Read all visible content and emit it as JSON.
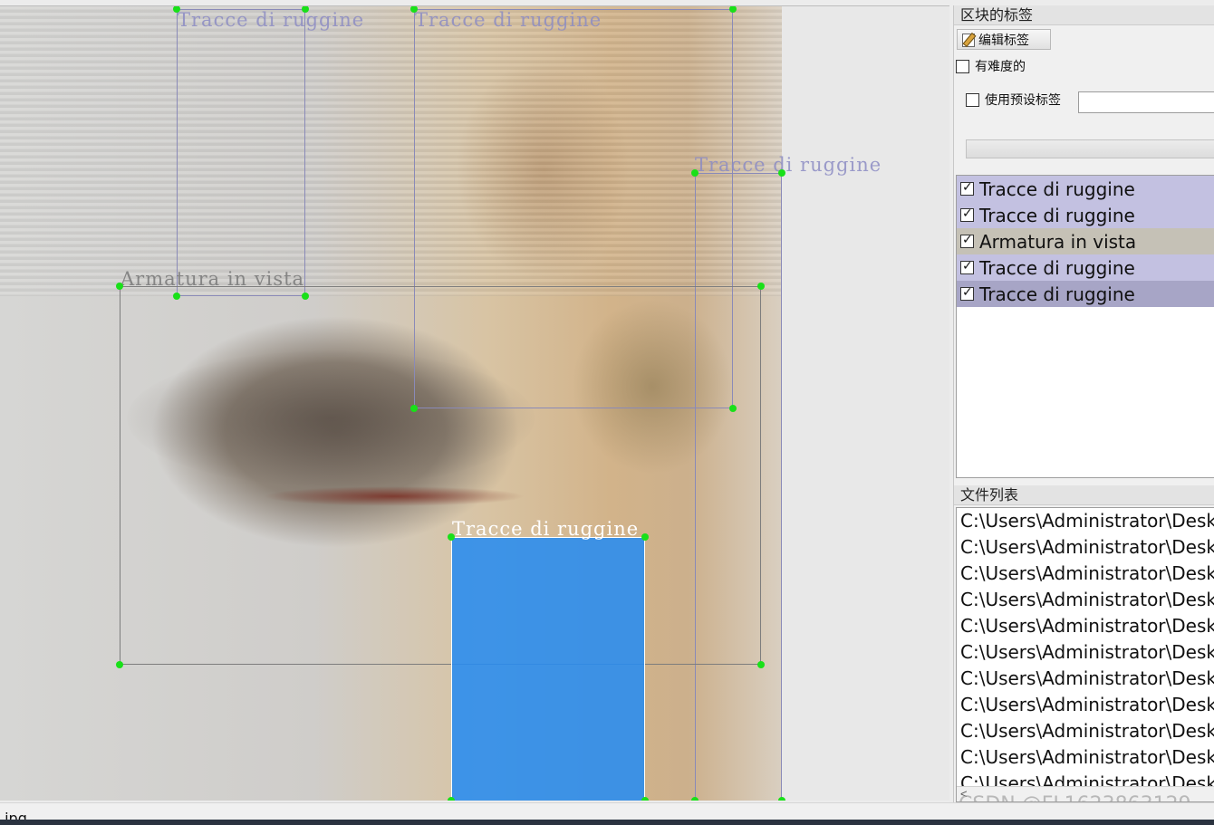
{
  "canvas": {
    "annotations": [
      {
        "label": "Tracce di ruggine",
        "color": "blue"
      },
      {
        "label": "Tracce di ruggine",
        "color": "blue"
      },
      {
        "label": "Tracce di ruggine",
        "color": "blue"
      },
      {
        "label": "Armatura in vista",
        "color": "gray"
      },
      {
        "label": "Tracce di ruggine",
        "color": "white",
        "selected": true
      }
    ]
  },
  "dock": {
    "box_labels_title": "区块的标签",
    "edit_label_button": "编辑标签",
    "difficult_label": "有难度的",
    "difficult_checked": false,
    "use_preset_label": "使用预设标签",
    "use_preset_checked": false,
    "preset_value": "",
    "label_items": [
      {
        "text": "Tracce di ruggine",
        "checked": true,
        "bg": "#c3c1e1"
      },
      {
        "text": "Tracce di ruggine",
        "checked": true,
        "bg": "#c3c1e1"
      },
      {
        "text": "Armatura in vista",
        "checked": true,
        "bg": "#c5c1b6"
      },
      {
        "text": "Tracce di ruggine",
        "checked": true,
        "bg": "#c3c1e1"
      },
      {
        "text": "Tracce di ruggine",
        "checked": true,
        "bg": "#a7a5c6"
      }
    ],
    "file_list_title": "文件列表",
    "files": [
      "C:\\Users\\Administrator\\Desktop",
      "C:\\Users\\Administrator\\Desktop",
      "C:\\Users\\Administrator\\Desktop",
      "C:\\Users\\Administrator\\Desktop",
      "C:\\Users\\Administrator\\Desktop",
      "C:\\Users\\Administrator\\Desktop",
      "C:\\Users\\Administrator\\Desktop",
      "C:\\Users\\Administrator\\Desktop",
      "C:\\Users\\Administrator\\Desktop",
      "C:\\Users\\Administrator\\Desktop",
      "C:\\Users\\Administrator\\Desktop"
    ],
    "scroll_left_glyph": "<"
  },
  "status": {
    "text": ".jpg"
  },
  "watermark": "CSDN @FL1623863129"
}
